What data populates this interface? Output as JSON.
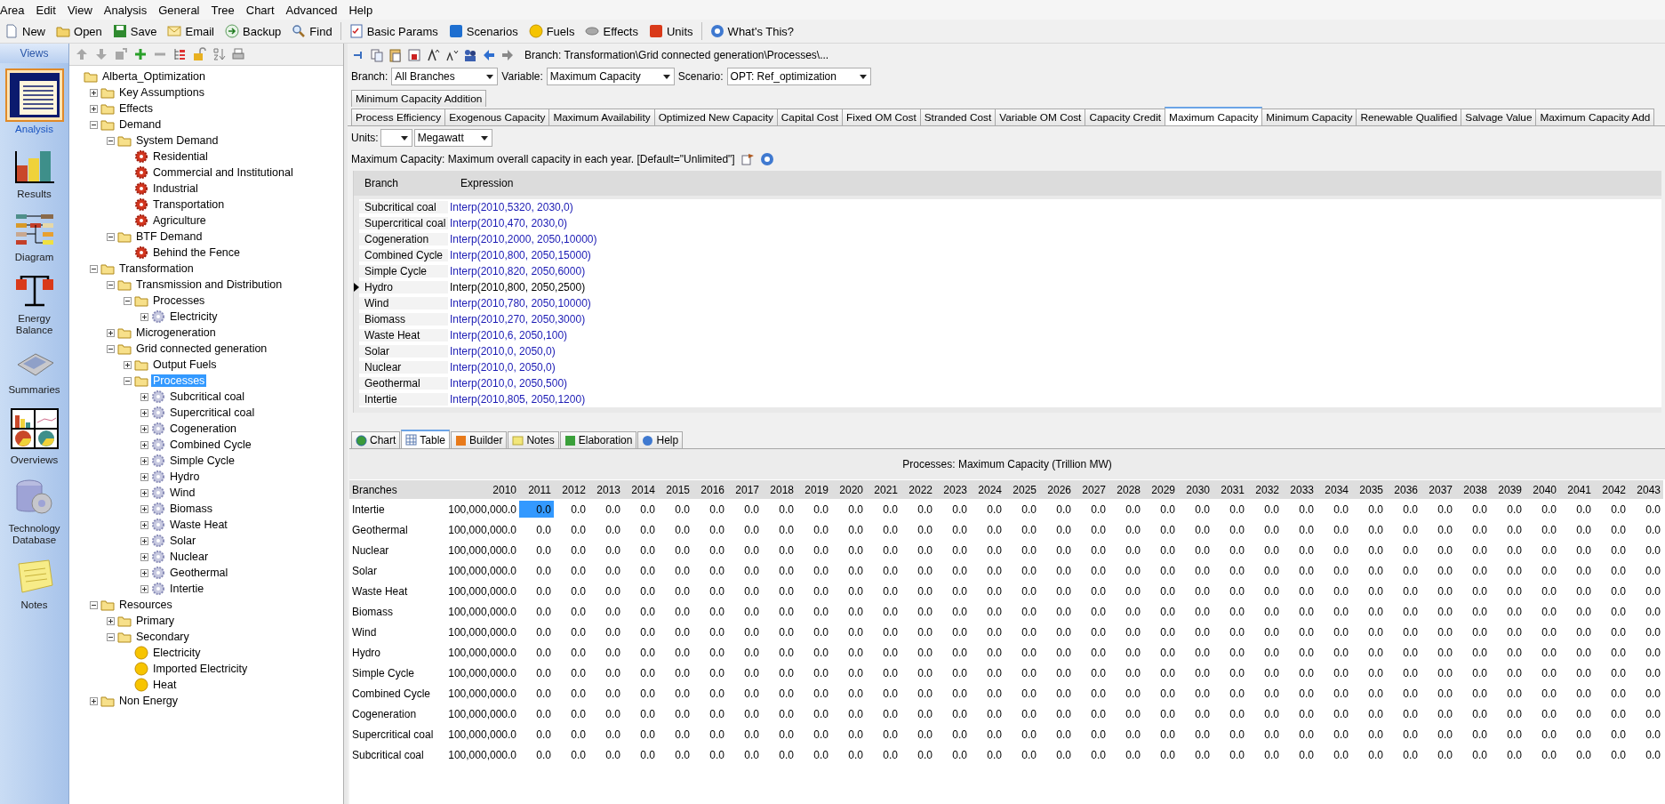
{
  "menu": [
    "Area",
    "Edit",
    "View",
    "Analysis",
    "General",
    "Tree",
    "Chart",
    "Advanced",
    "Help"
  ],
  "toolbar": {
    "groups": [
      [
        {
          "label": "New"
        },
        {
          "label": "Open"
        },
        {
          "label": "Save"
        },
        {
          "label": "Email"
        },
        {
          "label": "Backup"
        },
        {
          "label": "Find"
        }
      ],
      [
        {
          "label": "Basic Params"
        },
        {
          "label": "Scenarios"
        },
        {
          "label": "Fuels"
        },
        {
          "label": "Effects"
        },
        {
          "label": "Units"
        }
      ],
      [
        {
          "label": "What's This?"
        }
      ]
    ]
  },
  "views": {
    "title": "Views",
    "items": [
      {
        "label": "Analysis",
        "selected": true
      },
      {
        "label": "Results",
        "selected": false
      },
      {
        "label": "Diagram",
        "selected": false
      },
      {
        "label": "Energy Balance",
        "selected": false
      },
      {
        "label": "Summaries",
        "selected": false
      },
      {
        "label": "Overviews",
        "selected": false
      },
      {
        "label": "Technology Database",
        "selected": false
      },
      {
        "label": "Notes",
        "selected": false
      }
    ]
  },
  "tree": [
    {
      "label": "Alberta_Optimization",
      "kind": "folder",
      "selected": false,
      "children": [
        {
          "label": "Key Assumptions",
          "kind": "folder",
          "expanded": false,
          "selected": false
        },
        {
          "label": "Effects",
          "kind": "folder",
          "expanded": false,
          "selected": false
        },
        {
          "label": "Demand",
          "kind": "folder",
          "expanded": true,
          "selected": false,
          "children": [
            {
              "label": "System Demand",
              "kind": "folder",
              "expanded": true,
              "selected": false,
              "children": [
                {
                  "label": "Residential",
                  "kind": "demand",
                  "selected": false
                },
                {
                  "label": "Commercial and Institutional",
                  "kind": "demand",
                  "selected": false
                },
                {
                  "label": "Industrial",
                  "kind": "demand",
                  "selected": false
                },
                {
                  "label": "Transportation",
                  "kind": "demand",
                  "selected": false
                },
                {
                  "label": "Agriculture",
                  "kind": "demand",
                  "selected": false
                }
              ]
            },
            {
              "label": "BTF Demand",
              "kind": "folder",
              "expanded": true,
              "selected": false,
              "children": [
                {
                  "label": "Behind the Fence",
                  "kind": "demand",
                  "selected": false
                }
              ]
            }
          ]
        },
        {
          "label": "Transformation",
          "kind": "folder",
          "expanded": true,
          "selected": false,
          "children": [
            {
              "label": "Transmission and Distribution",
              "kind": "folder",
              "expanded": true,
              "selected": false,
              "children": [
                {
                  "label": "Processes",
                  "kind": "folder",
                  "expanded": true,
                  "selected": false,
                  "children": [
                    {
                      "label": "Electricity",
                      "kind": "process",
                      "expanded": false,
                      "selected": false
                    }
                  ]
                }
              ]
            },
            {
              "label": "Microgeneration",
              "kind": "folder",
              "expanded": false,
              "selected": false
            },
            {
              "label": "Grid connected generation",
              "kind": "folder",
              "expanded": true,
              "selected": false,
              "children": [
                {
                  "label": "Output Fuels",
                  "kind": "folder",
                  "expanded": false,
                  "selected": false
                },
                {
                  "label": "Processes",
                  "kind": "folder",
                  "expanded": true,
                  "selected": true,
                  "children": [
                    {
                      "label": "Subcritical coal",
                      "kind": "process",
                      "expanded": false,
                      "selected": false
                    },
                    {
                      "label": "Supercritical coal",
                      "kind": "process",
                      "expanded": false,
                      "selected": false
                    },
                    {
                      "label": "Cogeneration",
                      "kind": "process",
                      "expanded": false,
                      "selected": false
                    },
                    {
                      "label": "Combined Cycle",
                      "kind": "process",
                      "expanded": false,
                      "selected": false
                    },
                    {
                      "label": "Simple Cycle",
                      "kind": "process",
                      "expanded": false,
                      "selected": false
                    },
                    {
                      "label": "Hydro",
                      "kind": "process",
                      "expanded": false,
                      "selected": false
                    },
                    {
                      "label": "Wind",
                      "kind": "process",
                      "expanded": false,
                      "selected": false
                    },
                    {
                      "label": "Biomass",
                      "kind": "process",
                      "expanded": false,
                      "selected": false
                    },
                    {
                      "label": "Waste Heat",
                      "kind": "process",
                      "expanded": false,
                      "selected": false
                    },
                    {
                      "label": "Solar",
                      "kind": "process",
                      "expanded": false,
                      "selected": false
                    },
                    {
                      "label": "Nuclear",
                      "kind": "process",
                      "expanded": false,
                      "selected": false
                    },
                    {
                      "label": "Geothermal",
                      "kind": "process",
                      "expanded": false,
                      "selected": false
                    },
                    {
                      "label": "Intertie",
                      "kind": "process",
                      "expanded": false,
                      "selected": false
                    }
                  ]
                }
              ]
            }
          ]
        },
        {
          "label": "Resources",
          "kind": "folder",
          "expanded": true,
          "selected": false,
          "children": [
            {
              "label": "Primary",
              "kind": "folder",
              "expanded": false,
              "selected": false
            },
            {
              "label": "Secondary",
              "kind": "folder",
              "expanded": true,
              "selected": false,
              "children": [
                {
                  "label": "Electricity",
                  "kind": "fuel",
                  "selected": false
                },
                {
                  "label": "Imported Electricity",
                  "kind": "fuel",
                  "selected": false
                },
                {
                  "label": "Heat",
                  "kind": "fuel",
                  "selected": false
                }
              ]
            }
          ]
        },
        {
          "label": "Non Energy",
          "kind": "folder",
          "expanded": false,
          "selected": false
        }
      ]
    }
  ],
  "breadcrumb": "Branch: Transformation\\Grid connected generation\\Processes\\...",
  "selectors": [
    {
      "label": "Branch:",
      "value": "All Branches"
    },
    {
      "label": "Variable:",
      "value": "Maximum Capacity"
    },
    {
      "label": "Scenario:",
      "value": "OPT: Ref_optimization"
    }
  ],
  "tabs_upper": [
    {
      "label": "Minimum Capacity Addition",
      "selected": false
    }
  ],
  "tabs": [
    {
      "label": "Process Efficiency",
      "selected": false
    },
    {
      "label": "Exogenous Capacity",
      "selected": false
    },
    {
      "label": "Maximum Availability",
      "selected": false
    },
    {
      "label": "Optimized New Capacity",
      "selected": false
    },
    {
      "label": "Capital Cost",
      "selected": false
    },
    {
      "label": "Fixed OM Cost",
      "selected": false
    },
    {
      "label": "Stranded Cost",
      "selected": false
    },
    {
      "label": "Variable OM Cost",
      "selected": false
    },
    {
      "label": "Capacity Credit",
      "selected": false
    },
    {
      "label": "Maximum Capacity",
      "selected": true
    },
    {
      "label": "Minimum Capacity",
      "selected": false
    },
    {
      "label": "Renewable Qualified",
      "selected": false
    },
    {
      "label": "Salvage Value",
      "selected": false
    },
    {
      "label": "Maximum Capacity Add",
      "selected": false
    }
  ],
  "units": {
    "label": "Units:",
    "unit": "Megawatt"
  },
  "description": "Maximum Capacity: Maximum overall capacity in each year. [Default=\"Unlimited\"]",
  "expressions": {
    "columns": [
      "Branch",
      "Expression"
    ],
    "rows": [
      {
        "branch": "Subcritical coal",
        "expression": "Interp(2010,5320, 2030,0)",
        "selected": false
      },
      {
        "branch": "Supercritical coal",
        "expression": "Interp(2010,470, 2030,0)",
        "selected": false
      },
      {
        "branch": "Cogeneration",
        "expression": "Interp(2010,2000, 2050,10000)",
        "selected": false
      },
      {
        "branch": "Combined Cycle",
        "expression": "Interp(2010,800, 2050,15000)",
        "selected": false
      },
      {
        "branch": "Simple Cycle",
        "expression": "Interp(2010,820, 2050,6000)",
        "selected": false
      },
      {
        "branch": "Hydro",
        "expression": "Interp(2010,800, 2050,2500)",
        "selected": true
      },
      {
        "branch": "Wind",
        "expression": "Interp(2010,780, 2050,10000)",
        "selected": false
      },
      {
        "branch": "Biomass",
        "expression": "Interp(2010,270, 2050,3000)",
        "selected": false
      },
      {
        "branch": "Waste Heat",
        "expression": "Interp(2010,6, 2050,100)",
        "selected": false
      },
      {
        "branch": "Solar",
        "expression": "Interp(2010,0, 2050,0)",
        "selected": false
      },
      {
        "branch": "Nuclear",
        "expression": "Interp(2010,0, 2050,0)",
        "selected": false
      },
      {
        "branch": "Geothermal",
        "expression": "Interp(2010,0, 2050,500)",
        "selected": false
      },
      {
        "branch": "Intertie",
        "expression": "Interp(2010,805, 2050,1200)",
        "selected": false
      }
    ]
  },
  "result_tabs": [
    {
      "label": "Chart",
      "selected": false
    },
    {
      "label": "Table",
      "selected": true
    },
    {
      "label": "Builder",
      "selected": false
    },
    {
      "label": "Notes",
      "selected": false
    },
    {
      "label": "Elaboration",
      "selected": false
    },
    {
      "label": "Help",
      "selected": false
    }
  ],
  "table": {
    "title": "Processes: Maximum Capacity (Trillion MW)",
    "branch_header": "Branches",
    "columns": [
      "2010",
      "2011",
      "2012",
      "2013",
      "2014",
      "2015",
      "2016",
      "2017",
      "2018",
      "2019",
      "2020",
      "2021",
      "2022",
      "2023",
      "2024",
      "2025",
      "2026",
      "2027",
      "2028",
      "2029",
      "2030",
      "2031",
      "2032",
      "2033",
      "2034",
      "2035",
      "2036",
      "2037",
      "2038",
      "2039",
      "2040",
      "2041",
      "2042",
      "2043"
    ],
    "rows": [
      {
        "branch": "Intertie",
        "values": [
          "100,000,000.0",
          "0.0",
          "0.0",
          "0.0",
          "0.0",
          "0.0",
          "0.0",
          "0.0",
          "0.0",
          "0.0",
          "0.0",
          "0.0",
          "0.0",
          "0.0",
          "0.0",
          "0.0",
          "0.0",
          "0.0",
          "0.0",
          "0.0",
          "0.0",
          "0.0",
          "0.0",
          "0.0",
          "0.0",
          "0.0",
          "0.0",
          "0.0",
          "0.0",
          "0.0",
          "0.0",
          "0.0",
          "0.0",
          "0.0"
        ],
        "selected_values": [
          false,
          true,
          false,
          false,
          false,
          false,
          false,
          false,
          false,
          false,
          false,
          false,
          false,
          false,
          false,
          false,
          false,
          false,
          false,
          false,
          false,
          false,
          false,
          false,
          false,
          false,
          false,
          false,
          false,
          false,
          false,
          false,
          false,
          false
        ]
      },
      {
        "branch": "Geothermal",
        "values": [
          "100,000,000.0",
          "0.0",
          "0.0",
          "0.0",
          "0.0",
          "0.0",
          "0.0",
          "0.0",
          "0.0",
          "0.0",
          "0.0",
          "0.0",
          "0.0",
          "0.0",
          "0.0",
          "0.0",
          "0.0",
          "0.0",
          "0.0",
          "0.0",
          "0.0",
          "0.0",
          "0.0",
          "0.0",
          "0.0",
          "0.0",
          "0.0",
          "0.0",
          "0.0",
          "0.0",
          "0.0",
          "0.0",
          "0.0",
          "0.0"
        ],
        "selected_values": [
          false,
          false,
          false,
          false,
          false,
          false,
          false,
          false,
          false,
          false,
          false,
          false,
          false,
          false,
          false,
          false,
          false,
          false,
          false,
          false,
          false,
          false,
          false,
          false,
          false,
          false,
          false,
          false,
          false,
          false,
          false,
          false,
          false,
          false
        ]
      },
      {
        "branch": "Nuclear",
        "values": [
          "100,000,000.0",
          "0.0",
          "0.0",
          "0.0",
          "0.0",
          "0.0",
          "0.0",
          "0.0",
          "0.0",
          "0.0",
          "0.0",
          "0.0",
          "0.0",
          "0.0",
          "0.0",
          "0.0",
          "0.0",
          "0.0",
          "0.0",
          "0.0",
          "0.0",
          "0.0",
          "0.0",
          "0.0",
          "0.0",
          "0.0",
          "0.0",
          "0.0",
          "0.0",
          "0.0",
          "0.0",
          "0.0",
          "0.0",
          "0.0"
        ],
        "selected_values": [
          false,
          false,
          false,
          false,
          false,
          false,
          false,
          false,
          false,
          false,
          false,
          false,
          false,
          false,
          false,
          false,
          false,
          false,
          false,
          false,
          false,
          false,
          false,
          false,
          false,
          false,
          false,
          false,
          false,
          false,
          false,
          false,
          false,
          false
        ]
      },
      {
        "branch": "Solar",
        "values": [
          "100,000,000.0",
          "0.0",
          "0.0",
          "0.0",
          "0.0",
          "0.0",
          "0.0",
          "0.0",
          "0.0",
          "0.0",
          "0.0",
          "0.0",
          "0.0",
          "0.0",
          "0.0",
          "0.0",
          "0.0",
          "0.0",
          "0.0",
          "0.0",
          "0.0",
          "0.0",
          "0.0",
          "0.0",
          "0.0",
          "0.0",
          "0.0",
          "0.0",
          "0.0",
          "0.0",
          "0.0",
          "0.0",
          "0.0",
          "0.0"
        ],
        "selected_values": [
          false,
          false,
          false,
          false,
          false,
          false,
          false,
          false,
          false,
          false,
          false,
          false,
          false,
          false,
          false,
          false,
          false,
          false,
          false,
          false,
          false,
          false,
          false,
          false,
          false,
          false,
          false,
          false,
          false,
          false,
          false,
          false,
          false,
          false
        ]
      },
      {
        "branch": "Waste Heat",
        "values": [
          "100,000,000.0",
          "0.0",
          "0.0",
          "0.0",
          "0.0",
          "0.0",
          "0.0",
          "0.0",
          "0.0",
          "0.0",
          "0.0",
          "0.0",
          "0.0",
          "0.0",
          "0.0",
          "0.0",
          "0.0",
          "0.0",
          "0.0",
          "0.0",
          "0.0",
          "0.0",
          "0.0",
          "0.0",
          "0.0",
          "0.0",
          "0.0",
          "0.0",
          "0.0",
          "0.0",
          "0.0",
          "0.0",
          "0.0",
          "0.0"
        ],
        "selected_values": [
          false,
          false,
          false,
          false,
          false,
          false,
          false,
          false,
          false,
          false,
          false,
          false,
          false,
          false,
          false,
          false,
          false,
          false,
          false,
          false,
          false,
          false,
          false,
          false,
          false,
          false,
          false,
          false,
          false,
          false,
          false,
          false,
          false,
          false
        ]
      },
      {
        "branch": "Biomass",
        "values": [
          "100,000,000.0",
          "0.0",
          "0.0",
          "0.0",
          "0.0",
          "0.0",
          "0.0",
          "0.0",
          "0.0",
          "0.0",
          "0.0",
          "0.0",
          "0.0",
          "0.0",
          "0.0",
          "0.0",
          "0.0",
          "0.0",
          "0.0",
          "0.0",
          "0.0",
          "0.0",
          "0.0",
          "0.0",
          "0.0",
          "0.0",
          "0.0",
          "0.0",
          "0.0",
          "0.0",
          "0.0",
          "0.0",
          "0.0",
          "0.0"
        ],
        "selected_values": [
          false,
          false,
          false,
          false,
          false,
          false,
          false,
          false,
          false,
          false,
          false,
          false,
          false,
          false,
          false,
          false,
          false,
          false,
          false,
          false,
          false,
          false,
          false,
          false,
          false,
          false,
          false,
          false,
          false,
          false,
          false,
          false,
          false,
          false
        ]
      },
      {
        "branch": "Wind",
        "values": [
          "100,000,000.0",
          "0.0",
          "0.0",
          "0.0",
          "0.0",
          "0.0",
          "0.0",
          "0.0",
          "0.0",
          "0.0",
          "0.0",
          "0.0",
          "0.0",
          "0.0",
          "0.0",
          "0.0",
          "0.0",
          "0.0",
          "0.0",
          "0.0",
          "0.0",
          "0.0",
          "0.0",
          "0.0",
          "0.0",
          "0.0",
          "0.0",
          "0.0",
          "0.0",
          "0.0",
          "0.0",
          "0.0",
          "0.0",
          "0.0"
        ],
        "selected_values": [
          false,
          false,
          false,
          false,
          false,
          false,
          false,
          false,
          false,
          false,
          false,
          false,
          false,
          false,
          false,
          false,
          false,
          false,
          false,
          false,
          false,
          false,
          false,
          false,
          false,
          false,
          false,
          false,
          false,
          false,
          false,
          false,
          false,
          false
        ]
      },
      {
        "branch": "Hydro",
        "values": [
          "100,000,000.0",
          "0.0",
          "0.0",
          "0.0",
          "0.0",
          "0.0",
          "0.0",
          "0.0",
          "0.0",
          "0.0",
          "0.0",
          "0.0",
          "0.0",
          "0.0",
          "0.0",
          "0.0",
          "0.0",
          "0.0",
          "0.0",
          "0.0",
          "0.0",
          "0.0",
          "0.0",
          "0.0",
          "0.0",
          "0.0",
          "0.0",
          "0.0",
          "0.0",
          "0.0",
          "0.0",
          "0.0",
          "0.0",
          "0.0"
        ],
        "selected_values": [
          false,
          false,
          false,
          false,
          false,
          false,
          false,
          false,
          false,
          false,
          false,
          false,
          false,
          false,
          false,
          false,
          false,
          false,
          false,
          false,
          false,
          false,
          false,
          false,
          false,
          false,
          false,
          false,
          false,
          false,
          false,
          false,
          false,
          false
        ]
      },
      {
        "branch": "Simple Cycle",
        "values": [
          "100,000,000.0",
          "0.0",
          "0.0",
          "0.0",
          "0.0",
          "0.0",
          "0.0",
          "0.0",
          "0.0",
          "0.0",
          "0.0",
          "0.0",
          "0.0",
          "0.0",
          "0.0",
          "0.0",
          "0.0",
          "0.0",
          "0.0",
          "0.0",
          "0.0",
          "0.0",
          "0.0",
          "0.0",
          "0.0",
          "0.0",
          "0.0",
          "0.0",
          "0.0",
          "0.0",
          "0.0",
          "0.0",
          "0.0",
          "0.0"
        ],
        "selected_values": [
          false,
          false,
          false,
          false,
          false,
          false,
          false,
          false,
          false,
          false,
          false,
          false,
          false,
          false,
          false,
          false,
          false,
          false,
          false,
          false,
          false,
          false,
          false,
          false,
          false,
          false,
          false,
          false,
          false,
          false,
          false,
          false,
          false,
          false
        ]
      },
      {
        "branch": "Combined Cycle",
        "values": [
          "100,000,000.0",
          "0.0",
          "0.0",
          "0.0",
          "0.0",
          "0.0",
          "0.0",
          "0.0",
          "0.0",
          "0.0",
          "0.0",
          "0.0",
          "0.0",
          "0.0",
          "0.0",
          "0.0",
          "0.0",
          "0.0",
          "0.0",
          "0.0",
          "0.0",
          "0.0",
          "0.0",
          "0.0",
          "0.0",
          "0.0",
          "0.0",
          "0.0",
          "0.0",
          "0.0",
          "0.0",
          "0.0",
          "0.0",
          "0.0"
        ],
        "selected_values": [
          false,
          false,
          false,
          false,
          false,
          false,
          false,
          false,
          false,
          false,
          false,
          false,
          false,
          false,
          false,
          false,
          false,
          false,
          false,
          false,
          false,
          false,
          false,
          false,
          false,
          false,
          false,
          false,
          false,
          false,
          false,
          false,
          false,
          false
        ]
      },
      {
        "branch": "Cogeneration",
        "values": [
          "100,000,000.0",
          "0.0",
          "0.0",
          "0.0",
          "0.0",
          "0.0",
          "0.0",
          "0.0",
          "0.0",
          "0.0",
          "0.0",
          "0.0",
          "0.0",
          "0.0",
          "0.0",
          "0.0",
          "0.0",
          "0.0",
          "0.0",
          "0.0",
          "0.0",
          "0.0",
          "0.0",
          "0.0",
          "0.0",
          "0.0",
          "0.0",
          "0.0",
          "0.0",
          "0.0",
          "0.0",
          "0.0",
          "0.0",
          "0.0"
        ],
        "selected_values": [
          false,
          false,
          false,
          false,
          false,
          false,
          false,
          false,
          false,
          false,
          false,
          false,
          false,
          false,
          false,
          false,
          false,
          false,
          false,
          false,
          false,
          false,
          false,
          false,
          false,
          false,
          false,
          false,
          false,
          false,
          false,
          false,
          false,
          false
        ]
      },
      {
        "branch": "Supercritical coal",
        "values": [
          "100,000,000.0",
          "0.0",
          "0.0",
          "0.0",
          "0.0",
          "0.0",
          "0.0",
          "0.0",
          "0.0",
          "0.0",
          "0.0",
          "0.0",
          "0.0",
          "0.0",
          "0.0",
          "0.0",
          "0.0",
          "0.0",
          "0.0",
          "0.0",
          "0.0",
          "0.0",
          "0.0",
          "0.0",
          "0.0",
          "0.0",
          "0.0",
          "0.0",
          "0.0",
          "0.0",
          "0.0",
          "0.0",
          "0.0",
          "0.0"
        ],
        "selected_values": [
          false,
          false,
          false,
          false,
          false,
          false,
          false,
          false,
          false,
          false,
          false,
          false,
          false,
          false,
          false,
          false,
          false,
          false,
          false,
          false,
          false,
          false,
          false,
          false,
          false,
          false,
          false,
          false,
          false,
          false,
          false,
          false,
          false,
          false
        ]
      },
      {
        "branch": "Subcritical coal",
        "values": [
          "100,000,000.0",
          "0.0",
          "0.0",
          "0.0",
          "0.0",
          "0.0",
          "0.0",
          "0.0",
          "0.0",
          "0.0",
          "0.0",
          "0.0",
          "0.0",
          "0.0",
          "0.0",
          "0.0",
          "0.0",
          "0.0",
          "0.0",
          "0.0",
          "0.0",
          "0.0",
          "0.0",
          "0.0",
          "0.0",
          "0.0",
          "0.0",
          "0.0",
          "0.0",
          "0.0",
          "0.0",
          "0.0",
          "0.0",
          "0.0"
        ],
        "selected_values": [
          false,
          false,
          false,
          false,
          false,
          false,
          false,
          false,
          false,
          false,
          false,
          false,
          false,
          false,
          false,
          false,
          false,
          false,
          false,
          false,
          false,
          false,
          false,
          false,
          false,
          false,
          false,
          false,
          false,
          false,
          false,
          false,
          false,
          false
        ]
      }
    ]
  }
}
